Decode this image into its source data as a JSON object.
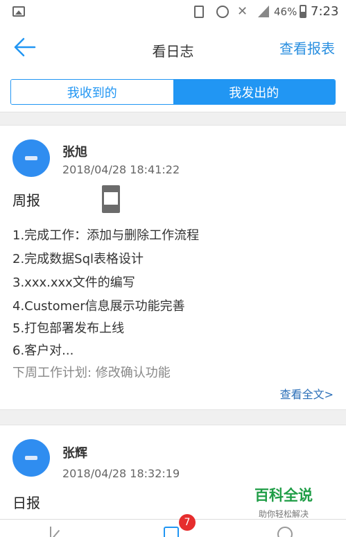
{
  "status_bar": {
    "battery": "46%",
    "time": "7:23",
    "icons": [
      "gallery-icon",
      "vibrate-icon",
      "alarm-icon",
      "wifi-icon",
      "signal-icon",
      "battery-icon"
    ]
  },
  "nav": {
    "title": "看日志",
    "report_label": "查看报表",
    "back_icon": "back-arrow-icon"
  },
  "segment": {
    "received_label": "我收到的",
    "sent_label": "我发出的",
    "active": "sent"
  },
  "logs": [
    {
      "name": "张旭",
      "date": "2018/04/28 18:41:22",
      "subject": "周报",
      "lines": [
        "1.完成工作：添加与删除工作流程",
        "2.完成数据Sql表格设计",
        "3.xxx.xxx文件的编写",
        "4.Customer信息展示功能完善",
        "5.打包部署发布上线",
        "6.客户对..."
      ],
      "plan_line": "下周工作计划: 修改确认功能",
      "more_label": "查看全文>"
    },
    {
      "name": "张辉",
      "date": "2018/04/28 18:32:19",
      "subject": "日报"
    }
  ],
  "watermark": {
    "title": "百科全说",
    "subtitle": "助你轻松解决"
  },
  "tabbar": {
    "badge_count": "7",
    "icons": [
      "write-log-icon",
      "view-log-icon",
      "stats-icon"
    ]
  },
  "colors": {
    "accent": "#2196f3",
    "avatar": "#2f8df0",
    "badge": "#e62d2d",
    "link": "#2b6fb8",
    "watermark": "#1f9d46"
  }
}
